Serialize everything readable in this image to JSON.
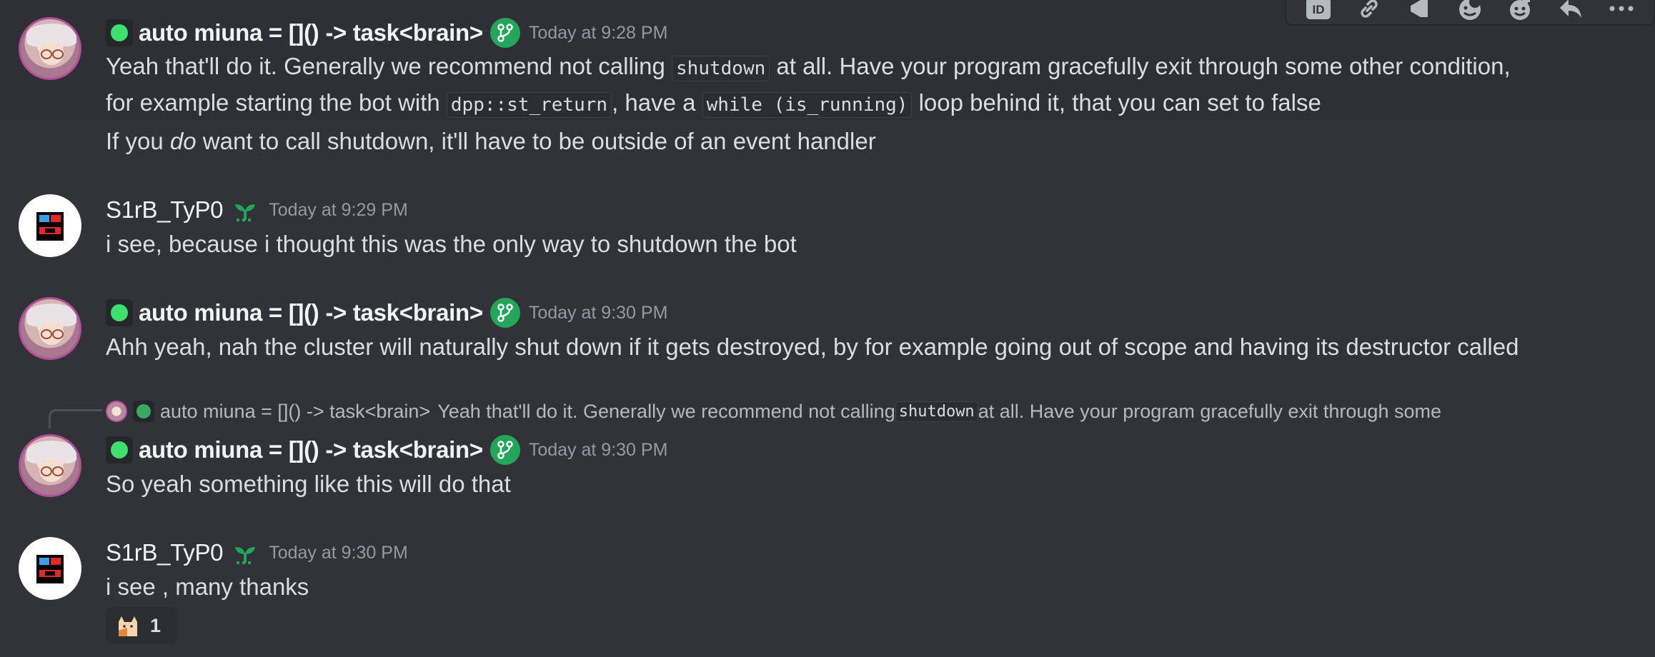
{
  "toolbar": {
    "icons": [
      "id-icon",
      "link-icon",
      "megaphone-icon",
      "moon-emoji-icon",
      "add-reaction-icon",
      "reply-icon",
      "more-icon"
    ],
    "id_label": "ID",
    "more_label": "···"
  },
  "messages": [
    {
      "author": "auto miuna = []() -> task<brain>",
      "timestamp": "Today at 9:28 PM",
      "line1_a": "Yeah that'll do it. Generally we recommend not calling ",
      "line1_code": "shutdown",
      "line1_b": " at all. Have your program gracefully exit through some other condition,",
      "line2_a": "for example starting the bot with ",
      "line2_code1": "dpp::st_return",
      "line2_b": ", have a ",
      "line2_code2": "while (is_running)",
      "line2_c": " loop behind it, that you can set to false",
      "line3_a": "If you ",
      "line3_em": "do",
      "line3_b": " want to call shutdown, it'll have to be outside of an event handler"
    },
    {
      "author": "S1rB_TyP0",
      "timestamp": "Today at 9:29 PM",
      "text": "i see, because i thought this was the only way to shutdown the bot"
    },
    {
      "author": "auto miuna = []() -> task<brain>",
      "timestamp": "Today at 9:30 PM",
      "text": "Ahh yeah, nah the cluster will naturally shut down if it gets destroyed, by for example going out of scope and having its destructor called"
    },
    {
      "reply_to": {
        "author": "auto miuna = []() -> task<brain>",
        "preview_a": "Yeah that'll do it. Generally we recommend not calling ",
        "preview_code": "shutdown",
        "preview_b": " at all. Have your program gracefully exit through some"
      },
      "author": "auto miuna = []() -> task<brain>",
      "timestamp": "Today at 9:30 PM",
      "text": "So yeah something like this will do that"
    },
    {
      "author": "S1rB_TyP0",
      "timestamp": "Today at 9:30 PM",
      "text": "i see , many thanks",
      "reaction": {
        "emoji": "cat-emoji",
        "count": "1"
      }
    }
  ],
  "colors": {
    "background": "#313338",
    "online_green": "#3ee06f",
    "branch_badge": "#23a55a",
    "timestamp": "#949ba4"
  }
}
